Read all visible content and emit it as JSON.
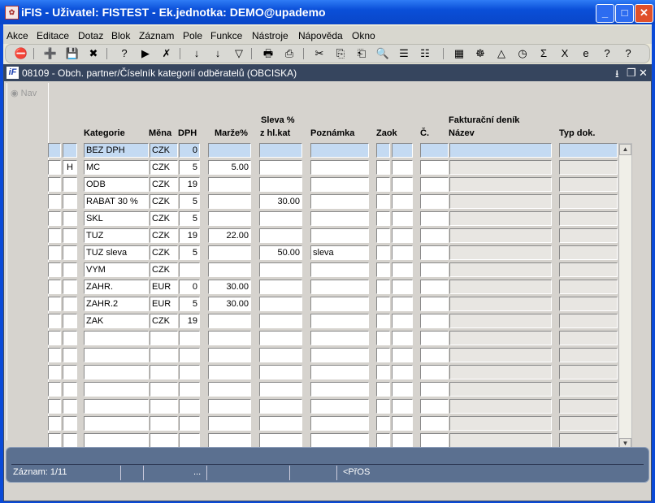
{
  "window": {
    "title": "iFIS - Uživatel: FISTEST - Ek.jednotka: DEMO@upademo"
  },
  "menu": [
    "Akce",
    "Editace",
    "Dotaz",
    "Blok",
    "Záznam",
    "Pole",
    "Funkce",
    "Nástroje",
    "Nápověda",
    "Okno"
  ],
  "toolbar": [
    "exit-icon",
    "insert-record-icon",
    "save-icon",
    "delete-record-icon",
    "query-enter-icon",
    "query-execute-icon",
    "query-cancel-icon",
    "sort-asc-icon",
    "sort-desc-icon",
    "filter-icon",
    "print-icon",
    "print-preview-icon",
    "cut-icon",
    "copy-icon",
    "paste-icon",
    "find-icon",
    "block-up-icon",
    "block-down-icon",
    "form-icon",
    "helm-icon",
    "warning-icon",
    "clock-icon",
    "sum-icon",
    "excel-icon",
    "ie-icon",
    "help-icon",
    "context-help-icon"
  ],
  "form": {
    "title": "08109 - Obch. partner/Číselník kategorií odběratelů (OBCISKA)",
    "nav": "Nav"
  },
  "headers": {
    "kategorie": "Kategorie",
    "mena": "Měna",
    "dph": "DPH",
    "marze": "Marže%",
    "sleva1": "Sleva %",
    "sleva2": "z hl.kat",
    "poznamka": "Poznámka",
    "zaok": "Zaok",
    "fakt": "Fakturační deník",
    "c": "Č.",
    "nazev": "Název",
    "typ": "Typ dok."
  },
  "rows": [
    {
      "f1": "",
      "f2": "",
      "kategorie": "BEZ DPH",
      "mena": "CZK",
      "dph": "0",
      "marze": "",
      "sleva": "",
      "poznamka": ""
    },
    {
      "f1": "",
      "f2": "H",
      "kategorie": "MC",
      "mena": "CZK",
      "dph": "5",
      "marze": "5.00",
      "sleva": "",
      "poznamka": ""
    },
    {
      "f1": "",
      "f2": "",
      "kategorie": "ODB",
      "mena": "CZK",
      "dph": "19",
      "marze": "",
      "sleva": "",
      "poznamka": ""
    },
    {
      "f1": "",
      "f2": "",
      "kategorie": "RABAT 30 %",
      "mena": "CZK",
      "dph": "5",
      "marze": "",
      "sleva": "30.00",
      "poznamka": ""
    },
    {
      "f1": "",
      "f2": "",
      "kategorie": "SKL",
      "mena": "CZK",
      "dph": "5",
      "marze": "",
      "sleva": "",
      "poznamka": ""
    },
    {
      "f1": "",
      "f2": "",
      "kategorie": "TUZ",
      "mena": "CZK",
      "dph": "19",
      "marze": "22.00",
      "sleva": "",
      "poznamka": ""
    },
    {
      "f1": "",
      "f2": "",
      "kategorie": "TUZ sleva",
      "mena": "CZK",
      "dph": "5",
      "marze": "",
      "sleva": "50.00",
      "poznamka": "sleva"
    },
    {
      "f1": "",
      "f2": "",
      "kategorie": "VYM",
      "mena": "CZK",
      "dph": "",
      "marze": "",
      "sleva": "",
      "poznamka": ""
    },
    {
      "f1": "",
      "f2": "",
      "kategorie": "ZAHR.",
      "mena": "EUR",
      "dph": "0",
      "marze": "30.00",
      "sleva": "",
      "poznamka": ""
    },
    {
      "f1": "",
      "f2": "",
      "kategorie": "ZAHR.2",
      "mena": "EUR",
      "dph": "5",
      "marze": "30.00",
      "sleva": "",
      "poznamka": ""
    },
    {
      "f1": "",
      "f2": "",
      "kategorie": "ZAK",
      "mena": "CZK",
      "dph": "19",
      "marze": "",
      "sleva": "",
      "poznamka": ""
    }
  ],
  "empty_rows": 7,
  "status": {
    "record": "Záznam: 1/11",
    "dots": "...",
    "mode": "<PřOS"
  }
}
